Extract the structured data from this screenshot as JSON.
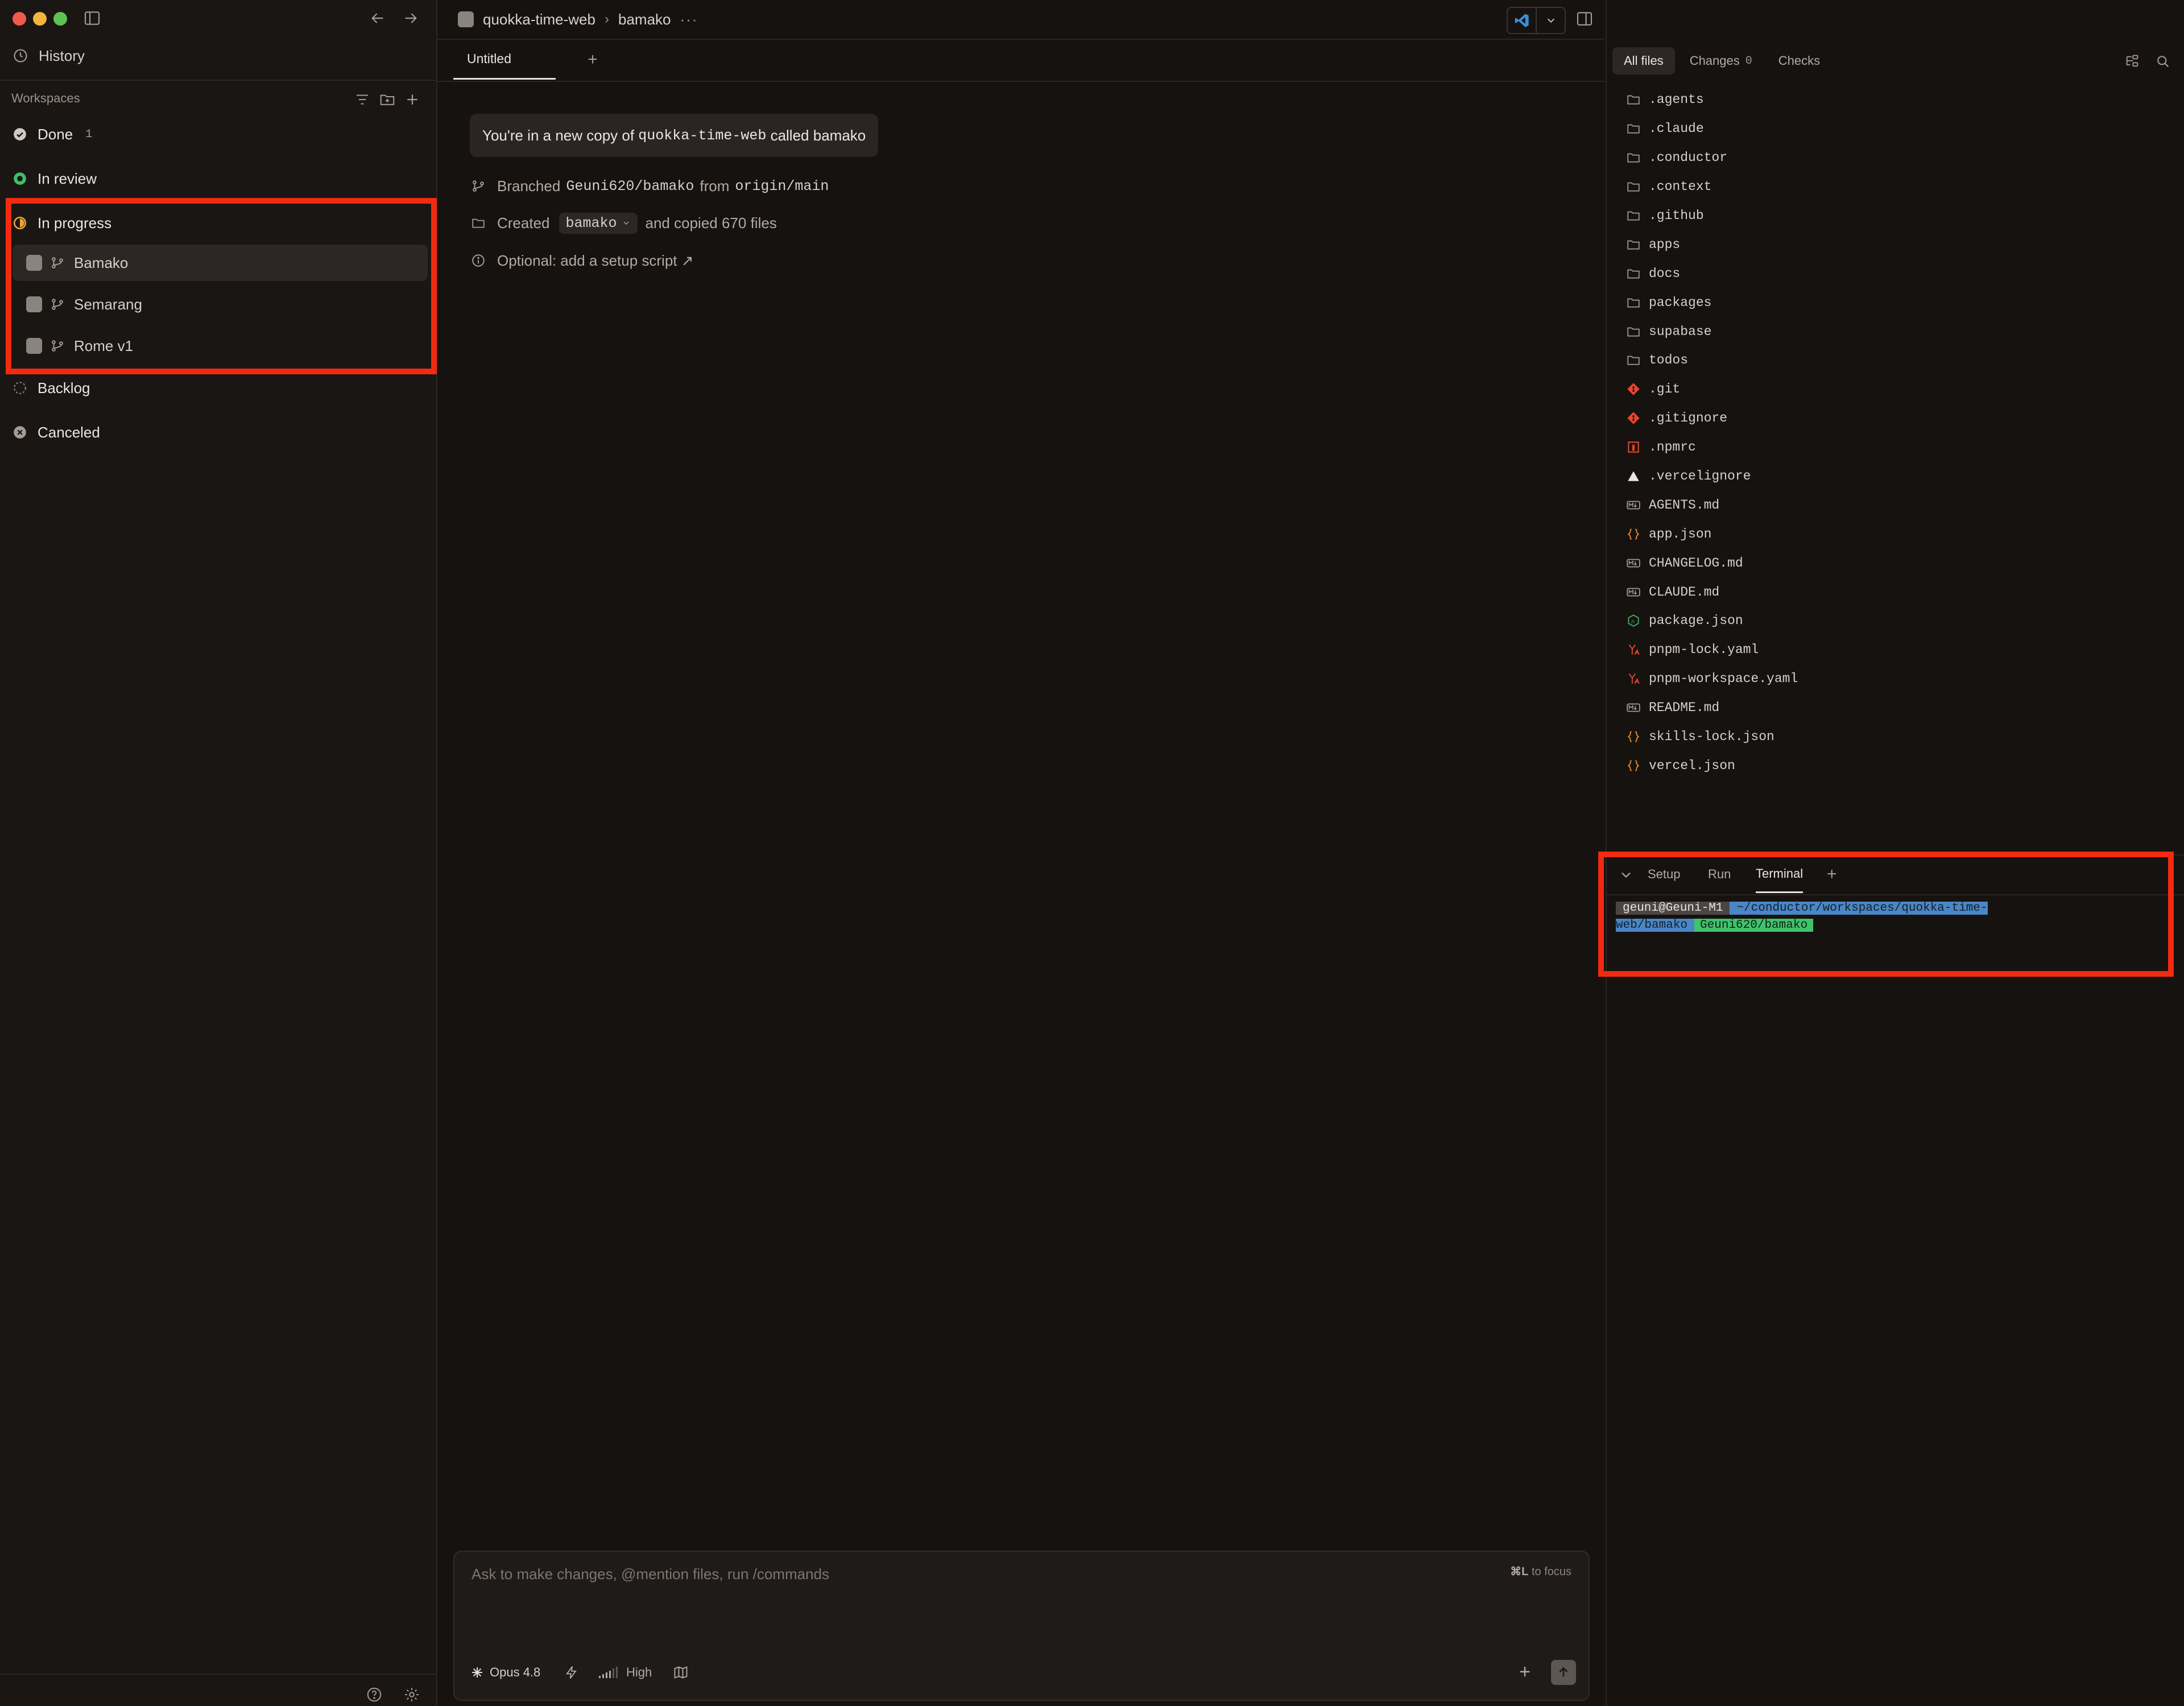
{
  "sidebar": {
    "history_label": "History",
    "workspaces_heading": "Workspaces",
    "groups": [
      {
        "label": "Done",
        "count": "1",
        "status": "done"
      },
      {
        "label": "In review",
        "status": "review"
      },
      {
        "label": "In progress",
        "status": "progress"
      },
      {
        "label": "Backlog",
        "status": "backlog"
      },
      {
        "label": "Canceled",
        "status": "canceled"
      }
    ],
    "in_progress_items": [
      "Bamako",
      "Semarang",
      "Rome v1"
    ]
  },
  "topbar": {
    "repo": "quokka-time-web",
    "workspace": "bamako",
    "more": "···"
  },
  "tabs": {
    "active": "Untitled",
    "add": "+"
  },
  "chat": {
    "notice_prefix": "You're in a new copy of ",
    "notice_repo": "quokka-time-web",
    "notice_mid": " called ",
    "notice_name": "bamako",
    "branched_word": "Branched",
    "branch_name": "Geuni620/bamako",
    "from_word": "from",
    "origin": "origin/main",
    "created_word": "Created",
    "created_dir": "bamako",
    "copied_text": "and copied 670 files",
    "optional_text": "Optional: add a setup script ↗"
  },
  "composer": {
    "placeholder": "Ask to make changes, @mention files, run /commands",
    "focus_key": "⌘L",
    "focus_text": "to focus",
    "model": "Opus 4.8",
    "effort": "High"
  },
  "right_panel": {
    "tabs": [
      {
        "label": "All files",
        "active": true
      },
      {
        "label": "Changes",
        "count": "0"
      },
      {
        "label": "Checks"
      }
    ],
    "files": [
      {
        "name": ".agents",
        "icon": "folder"
      },
      {
        "name": ".claude",
        "icon": "folder"
      },
      {
        "name": ".conductor",
        "icon": "folder"
      },
      {
        "name": ".context",
        "icon": "folder"
      },
      {
        "name": ".github",
        "icon": "folder"
      },
      {
        "name": "apps",
        "icon": "folder"
      },
      {
        "name": "docs",
        "icon": "folder"
      },
      {
        "name": "packages",
        "icon": "folder"
      },
      {
        "name": "supabase",
        "icon": "folder"
      },
      {
        "name": "todos",
        "icon": "folder"
      },
      {
        "name": ".git",
        "icon": "git"
      },
      {
        "name": ".gitignore",
        "icon": "git"
      },
      {
        "name": ".npmrc",
        "icon": "npm"
      },
      {
        "name": ".vercelignore",
        "icon": "vercel"
      },
      {
        "name": "AGENTS.md",
        "icon": "markdown"
      },
      {
        "name": "app.json",
        "icon": "json"
      },
      {
        "name": "CHANGELOG.md",
        "icon": "markdown"
      },
      {
        "name": "CLAUDE.md",
        "icon": "markdown"
      },
      {
        "name": "package.json",
        "icon": "node"
      },
      {
        "name": "pnpm-lock.yaml",
        "icon": "yaml"
      },
      {
        "name": "pnpm-workspace.yaml",
        "icon": "yaml"
      },
      {
        "name": "README.md",
        "icon": "markdown"
      },
      {
        "name": "skills-lock.json",
        "icon": "json"
      },
      {
        "name": "vercel.json",
        "icon": "json"
      }
    ],
    "terminal_tabs": [
      {
        "label": "Setup"
      },
      {
        "label": "Run"
      },
      {
        "label": "Terminal",
        "active": true
      }
    ],
    "terminal": {
      "user": "geuni@Geuni-M1",
      "path": "~/conductor/workspaces/quokka-time-web/bamako",
      "branch": "Geuni620/bamako"
    }
  },
  "colors": {
    "highlight": "#f12a10",
    "accent_progress": "#e8a436",
    "accent_review": "#3fbf6a",
    "terminal_path_bg": "#4a86c5",
    "terminal_git_bg": "#3fc36b"
  }
}
